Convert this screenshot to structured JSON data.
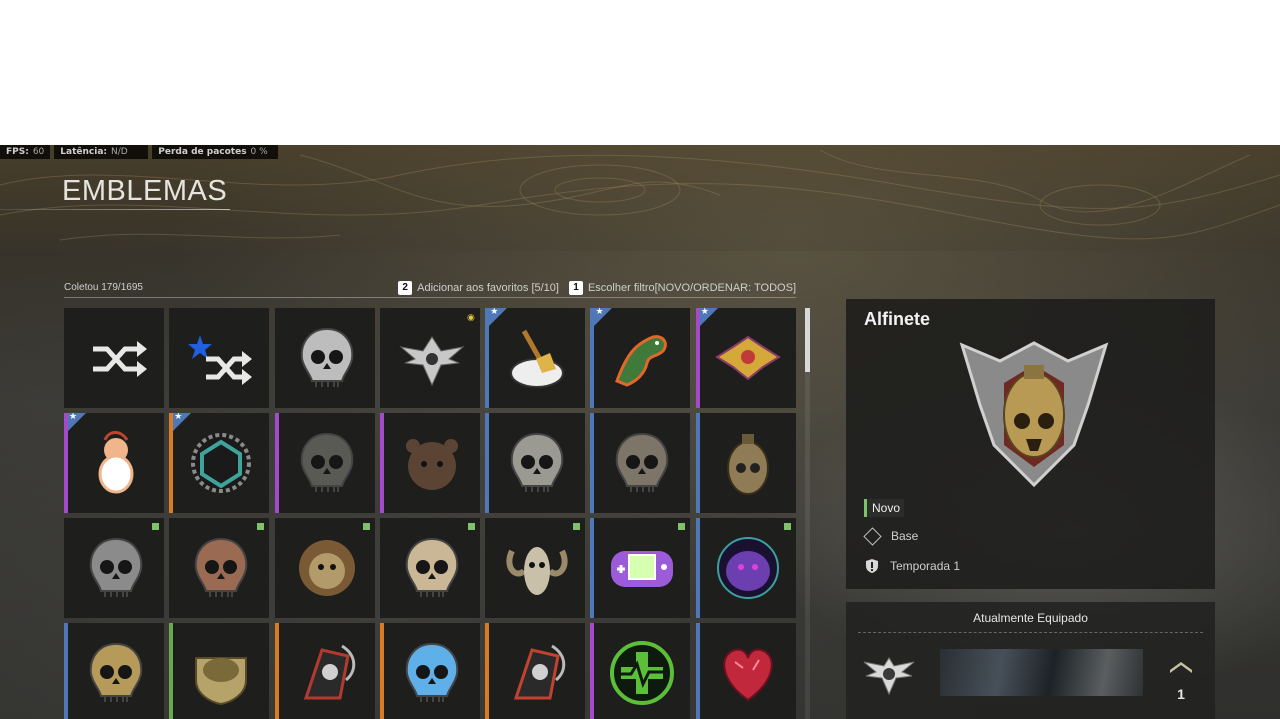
{
  "perf": {
    "fps_label": "FPS:",
    "fps_value": "60",
    "latency_label": "Latência:",
    "latency_value": "N/D",
    "packet_label": "Perda de pacotes",
    "packet_value": "0 %"
  },
  "page_title": "EMBLEMAS",
  "header": {
    "collected": "Coletou 179/1695",
    "fav_key": "2",
    "fav_label": "Adicionar aos favoritos [5/10]",
    "filter_key": "1",
    "filter_label": "Escolher filtro[NOVO/ORDENAR: TODOS]"
  },
  "grid": {
    "tiles": [
      {
        "icon": "shuffle-icon",
        "rarity": "none",
        "fav": false,
        "new": false
      },
      {
        "icon": "shuffle-favorite-icon",
        "rarity": "none",
        "fav": false,
        "new": false
      },
      {
        "icon": "hooded-skull-emblem",
        "rarity": "none",
        "fav": false,
        "new": false
      },
      {
        "icon": "winged-badge-emblem",
        "rarity": "none",
        "fav": false,
        "new": false,
        "gold": true
      },
      {
        "icon": "sweep-broom-emblem",
        "rarity": "blue",
        "fav": true,
        "new": false
      },
      {
        "icon": "fire-dinosaur-emblem",
        "rarity": "blue",
        "fav": true,
        "new": false
      },
      {
        "icon": "gold-jewel-emblem",
        "rarity": "purple",
        "fav": true,
        "new": false
      },
      {
        "icon": "cartoon-character-emblem",
        "rarity": "purple",
        "fav": true,
        "new": false
      },
      {
        "icon": "teal-gear-emblem",
        "rarity": "orange",
        "fav": true,
        "new": false
      },
      {
        "icon": "reaper-skull-emblem",
        "rarity": "purple",
        "fav": false,
        "new": false
      },
      {
        "icon": "bear-head-emblem",
        "rarity": "purple",
        "fav": false,
        "new": false
      },
      {
        "icon": "helmet-skull-emblem",
        "rarity": "blue",
        "fav": false,
        "new": false
      },
      {
        "icon": "bandana-skull-emblem",
        "rarity": "blue",
        "fav": false,
        "new": false
      },
      {
        "icon": "grenade-skull-emblem",
        "rarity": "blue",
        "fav": false,
        "new": false
      },
      {
        "icon": "gorilla-knives-emblem",
        "rarity": "none",
        "fav": false,
        "new": true
      },
      {
        "icon": "soldier-skull-emblem",
        "rarity": "none",
        "fav": false,
        "new": true
      },
      {
        "icon": "lion-emblem",
        "rarity": "none",
        "fav": false,
        "new": true
      },
      {
        "icon": "skull-crosshair-emblem",
        "rarity": "none",
        "fav": false,
        "new": true
      },
      {
        "icon": "ram-skull-emblem",
        "rarity": "none",
        "fav": false,
        "new": true
      },
      {
        "icon": "handheld-console-emblem",
        "rarity": "blue",
        "fav": false,
        "new": true
      },
      {
        "icon": "purple-beast-emblem",
        "rarity": "blue",
        "fav": false,
        "new": true
      },
      {
        "icon": "laurel-skull-emblem",
        "rarity": "blue",
        "fav": false,
        "new": false
      },
      {
        "icon": "helmet-shield-emblem",
        "rarity": "green",
        "fav": false,
        "new": false
      },
      {
        "icon": "reaper-scythe-emblem",
        "rarity": "orange",
        "fav": false,
        "new": false
      },
      {
        "icon": "electric-skull-emblem",
        "rarity": "orange",
        "fav": false,
        "new": false
      },
      {
        "icon": "fire-reaper-emblem",
        "rarity": "orange",
        "fav": false,
        "new": false
      },
      {
        "icon": "medic-heartbeat-emblem",
        "rarity": "purple",
        "fav": false,
        "new": false
      },
      {
        "icon": "red-heart-emblem",
        "rarity": "blue",
        "fav": false,
        "new": false
      }
    ]
  },
  "detail": {
    "name": "Alfinete",
    "tag": "Novo",
    "source": "Base",
    "season": "Temporada 1",
    "emblem_icon": "grenade-skull-pin-emblem"
  },
  "equipped": {
    "title": "Atualmente Equipado",
    "emblem_icon": "winged-badge-emblem",
    "rank": "1"
  },
  "colors": {
    "rarity_purple": "#a24cc9",
    "rarity_blue": "#4e78b8",
    "rarity_orange": "#d97b22",
    "rarity_green": "#6aa84f",
    "new_indicator": "#7ec36a"
  }
}
